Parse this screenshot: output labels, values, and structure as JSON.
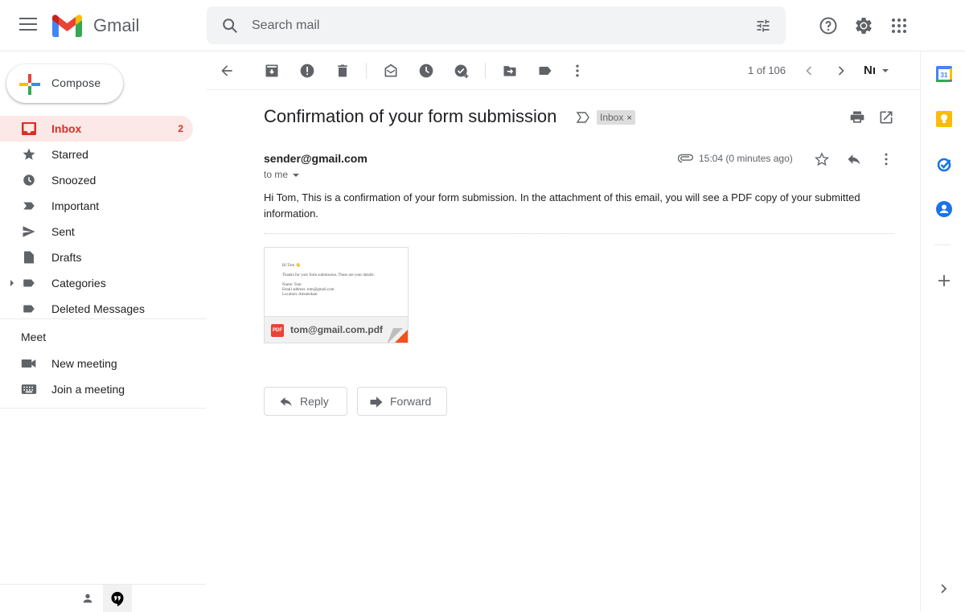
{
  "header": {
    "app_name": "Gmail",
    "search_placeholder": "Search mail",
    "search_value": ""
  },
  "sidebar": {
    "compose_label": "Compose",
    "items": [
      {
        "label": "Inbox",
        "icon": "inbox-icon",
        "count": "2",
        "active": true
      },
      {
        "label": "Starred",
        "icon": "star-icon"
      },
      {
        "label": "Snoozed",
        "icon": "clock-icon"
      },
      {
        "label": "Important",
        "icon": "important-icon"
      },
      {
        "label": "Sent",
        "icon": "send-icon"
      },
      {
        "label": "Drafts",
        "icon": "draft-icon"
      },
      {
        "label": "Categories",
        "icon": "label-icon"
      },
      {
        "label": "Deleted Messages",
        "icon": "label-icon"
      }
    ],
    "meet": {
      "title": "Meet",
      "items": [
        {
          "label": "New meeting",
          "icon": "video-camera-icon"
        },
        {
          "label": "Join a meeting",
          "icon": "keyboard-icon"
        }
      ]
    }
  },
  "toolbar": {
    "pager": "1 of 106",
    "input_tool": "Nı"
  },
  "email": {
    "subject": "Confirmation of your form submission",
    "label_chip": "Inbox",
    "label_remove": "×",
    "sender": "sender@gmail.com",
    "recipient": "to me",
    "timestamp": "15:04 (0 minutes ago)",
    "body": "Hi Tom, This is a confirmation of your form submission. In the attachment of this email, you will see a PDF copy of your submitted information.",
    "attachment": {
      "filename": "tom@gmail.com.pdf",
      "badge": "PDF",
      "preview_lines": [
        "Hi Tom 👋",
        "",
        "Thanks for your form submission. These are your details:",
        "",
        "Name: Tom",
        "Email address: tom@gmail.com",
        "Location: Amsterdam"
      ]
    },
    "reply_label": "Reply",
    "forward_label": "Forward"
  },
  "colors": {
    "accent_red": "#d93025",
    "active_bg": "#fce8e6",
    "icon_gray": "#5f6368"
  }
}
